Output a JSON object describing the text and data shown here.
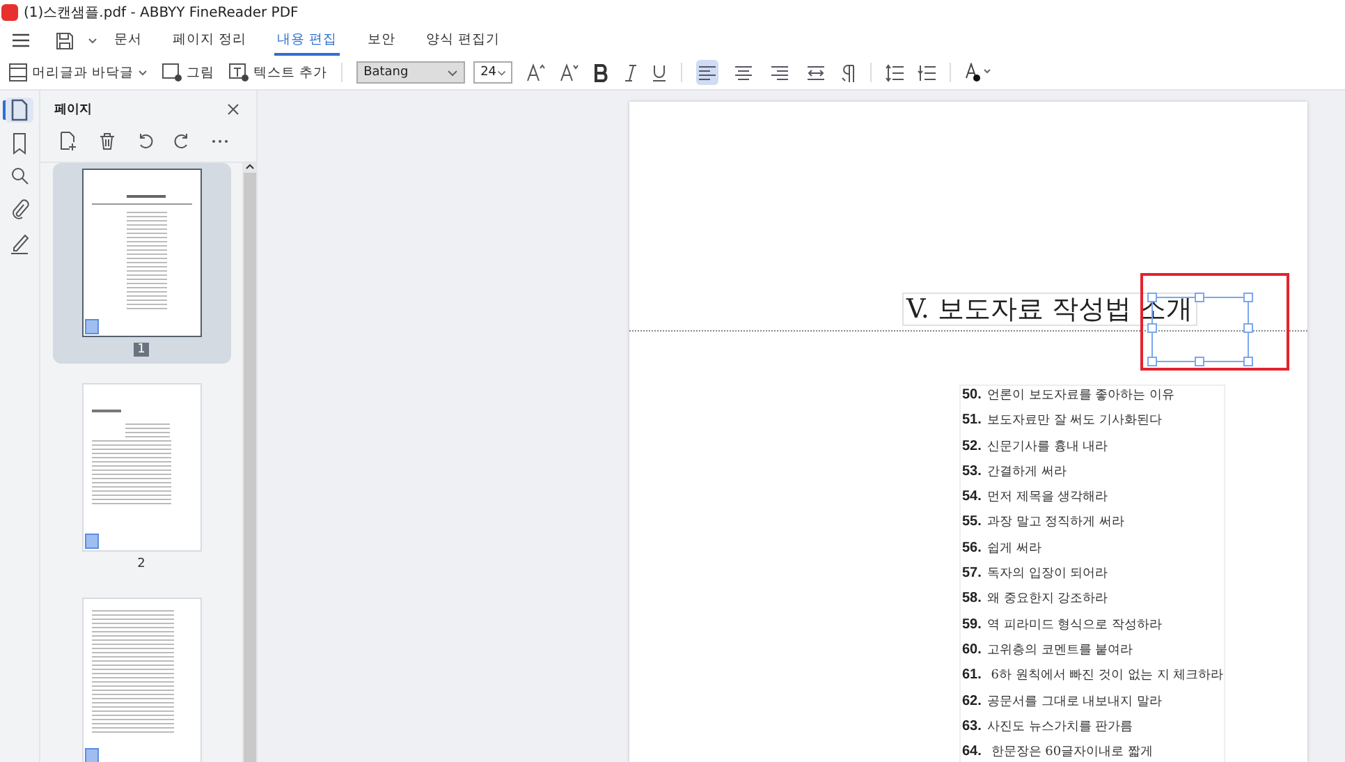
{
  "window": {
    "title": "(1)스캔샘플.pdf - ABBYY FineReader PDF"
  },
  "tabs": [
    {
      "label": "문서",
      "selected": false
    },
    {
      "label": "페이지 정리",
      "selected": false
    },
    {
      "label": "내용 편집",
      "selected": true
    },
    {
      "label": "보안",
      "selected": false
    },
    {
      "label": "양식 편집기",
      "selected": false
    }
  ],
  "toolbar": {
    "header_footer": "머리글과 바닥글",
    "picture": "그림",
    "add_text": "텍스트 추가",
    "font": "Batang",
    "size": "24",
    "aligns": [
      {
        "kind": "left",
        "selected": true
      },
      {
        "kind": "center",
        "selected": false
      },
      {
        "kind": "right",
        "selected": false
      },
      {
        "kind": "justify",
        "selected": false
      }
    ]
  },
  "rail": [
    {
      "kind": "pages",
      "selected": true
    },
    {
      "kind": "bookmark",
      "selected": false
    },
    {
      "kind": "search",
      "selected": false
    },
    {
      "kind": "attach",
      "selected": false
    },
    {
      "kind": "sign",
      "selected": false
    }
  ],
  "panel": {
    "title": "페이지",
    "thumbnails": [
      {
        "label": "1",
        "selected": true,
        "kind": "toc"
      },
      {
        "label": "2",
        "selected": false,
        "kind": "intro"
      },
      {
        "kind": "text",
        "selected": false
      }
    ]
  },
  "document": {
    "heading": "V. 보도자료 작성법 소개",
    "items": [
      {
        "num": "50.",
        "text": "언론이 보도자료를 좋아하는 이유"
      },
      {
        "num": "51.",
        "text": "보도자료만 잘 써도 기사화된다"
      },
      {
        "num": "52.",
        "text": "신문기사를 흉내 내라"
      },
      {
        "num": "53.",
        "text": "간결하게 써라"
      },
      {
        "num": "54.",
        "text": "먼저 제목을 생각해라"
      },
      {
        "num": "55.",
        "text": "과장 말고 정직하게 써라"
      },
      {
        "num": "56.",
        "text": "쉽게 써라"
      },
      {
        "num": "57.",
        "text": "독자의 입장이 되어라"
      },
      {
        "num": "58.",
        "text": "왜 중요한지 강조하라"
      },
      {
        "num": "59.",
        "text": "역 피라미드 형식으로 작성하라"
      },
      {
        "num": "60.",
        "text": "고위층의 코멘트를 붙여라"
      },
      {
        "num": "61.",
        "text": " 6하 원칙에서 빠진 것이 없는 지 체크하라"
      },
      {
        "num": "62.",
        "text": "공문서를 그대로 내보내지 말라"
      },
      {
        "num": "63.",
        "text": "사진도 뉴스가치를 판가름"
      },
      {
        "num": "64.",
        "text": " 한문장은 60글자이내로 짧게"
      }
    ]
  }
}
